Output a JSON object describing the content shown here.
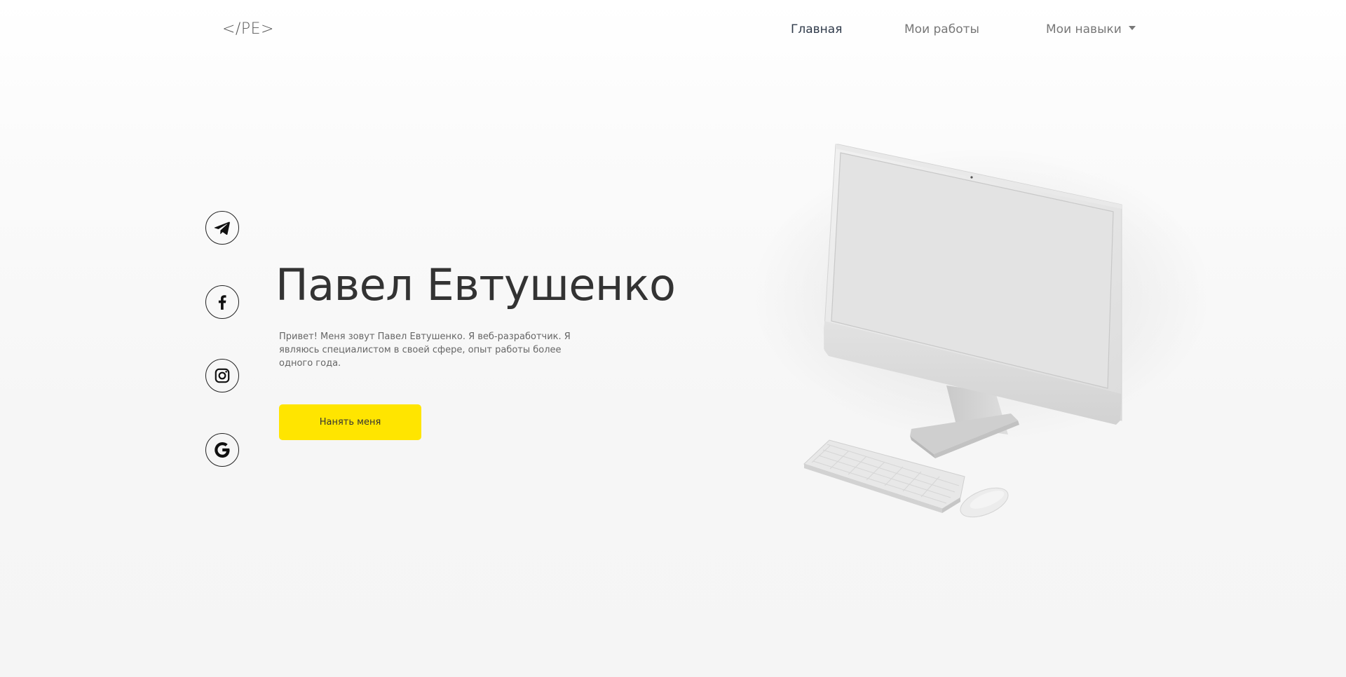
{
  "header": {
    "logo": "</PE>",
    "nav": {
      "home": "Главная",
      "works": "Мои работы",
      "skills": "Мои навыки"
    }
  },
  "social": {
    "items": [
      {
        "icon": "telegram-icon"
      },
      {
        "icon": "facebook-icon"
      },
      {
        "icon": "instagram-icon"
      },
      {
        "icon": "google-icon"
      }
    ]
  },
  "hero": {
    "title": "Павел Евтушенко",
    "description": "Привет! Меня зовут Павел Евтушенко. Я веб-разработчик. Я являюсь специалистом в своей сфере, опыт работы более одного года.",
    "button_label": "Нанять меня"
  },
  "colors": {
    "accent": "#ffe500",
    "text": "#333333",
    "muted": "#777777"
  }
}
